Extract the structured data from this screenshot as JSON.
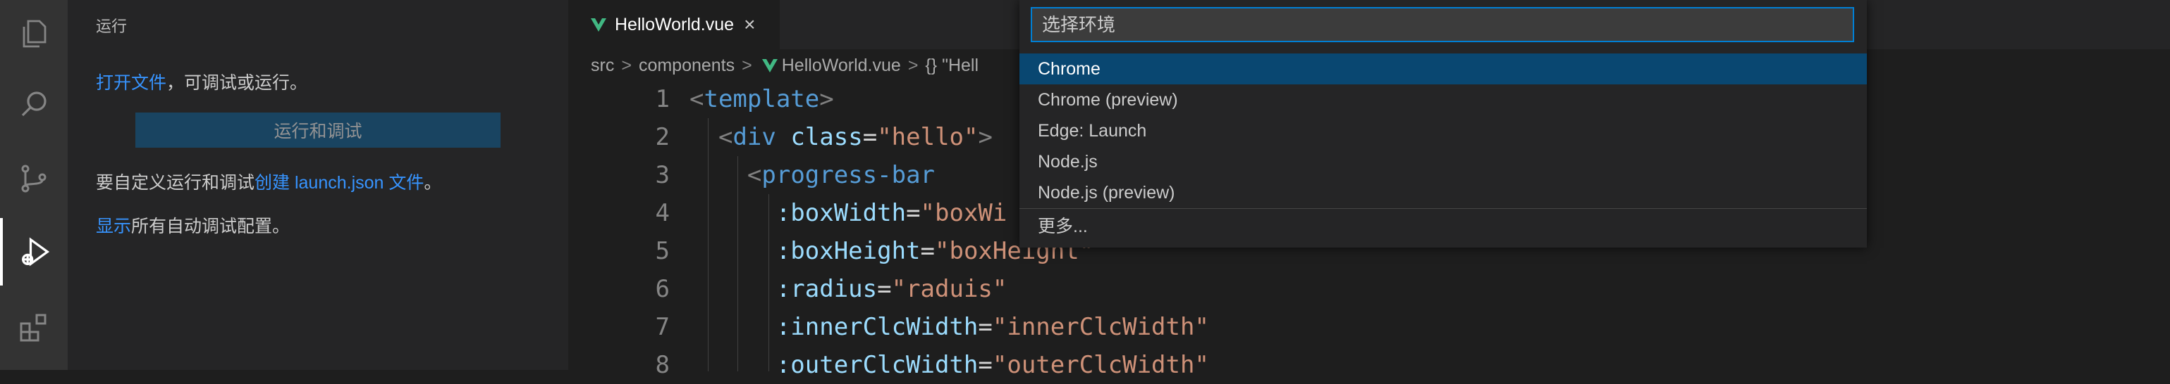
{
  "activity_bar": {
    "items": [
      {
        "name": "explorer-icon",
        "active": false
      },
      {
        "name": "search-icon",
        "active": false
      },
      {
        "name": "source-control-icon",
        "active": false
      },
      {
        "name": "run-debug-icon",
        "active": true
      },
      {
        "name": "extensions-icon",
        "active": false
      }
    ]
  },
  "sidebar": {
    "title": "运行",
    "open_file_link": "打开文件",
    "open_file_rest": "，可调试或运行。",
    "run_button": "运行和调试",
    "custom_prefix": "要自定义运行和调试",
    "create_link": "创建 launch.json 文件",
    "custom_suffix": "。",
    "show_link": "显示",
    "show_rest": "所有自动调试配置。"
  },
  "editor": {
    "tab": {
      "label": "HelloWorld.vue",
      "close": "×"
    },
    "breadcrumb": {
      "items": [
        "src",
        "components",
        "HelloWorld.vue",
        "{} \"Hell"
      ],
      "separator": ">"
    },
    "lines": [
      {
        "n": "1",
        "segs": [
          [
            "c-punc",
            "<"
          ],
          [
            "c-tag",
            "template"
          ],
          [
            "c-punc",
            ">"
          ]
        ]
      },
      {
        "n": "2",
        "segs": [
          [
            "c-plain",
            "  "
          ],
          [
            "c-punc",
            "<"
          ],
          [
            "c-tag",
            "div"
          ],
          [
            "c-plain",
            " "
          ],
          [
            "c-attr",
            "class"
          ],
          [
            "c-plain",
            "="
          ],
          [
            "c-str",
            "\"hello\""
          ],
          [
            "c-punc",
            ">"
          ]
        ]
      },
      {
        "n": "3",
        "segs": [
          [
            "c-plain",
            "    "
          ],
          [
            "c-punc",
            "<"
          ],
          [
            "c-tag",
            "progress-bar"
          ]
        ]
      },
      {
        "n": "4",
        "segs": [
          [
            "c-plain",
            "      "
          ],
          [
            "c-attr",
            ":boxWidth"
          ],
          [
            "c-plain",
            "="
          ],
          [
            "c-str",
            "\"boxWi"
          ]
        ]
      },
      {
        "n": "5",
        "segs": [
          [
            "c-plain",
            "      "
          ],
          [
            "c-attr",
            ":boxHeight"
          ],
          [
            "c-plain",
            "="
          ],
          [
            "c-str",
            "\"boxHeight\""
          ]
        ]
      },
      {
        "n": "6",
        "segs": [
          [
            "c-plain",
            "      "
          ],
          [
            "c-attr",
            ":radius"
          ],
          [
            "c-plain",
            "="
          ],
          [
            "c-str",
            "\"raduis\""
          ]
        ]
      },
      {
        "n": "7",
        "segs": [
          [
            "c-plain",
            "      "
          ],
          [
            "c-attr",
            ":innerClcWidth"
          ],
          [
            "c-plain",
            "="
          ],
          [
            "c-str",
            "\"innerClcWidth\""
          ]
        ]
      },
      {
        "n": "8",
        "segs": [
          [
            "c-plain",
            "      "
          ],
          [
            "c-attr",
            ":outerClcWidth"
          ],
          [
            "c-plain",
            "="
          ],
          [
            "c-str",
            "\"outerClcWidth\""
          ]
        ]
      }
    ]
  },
  "quick_pick": {
    "placeholder": "选择环境",
    "items": [
      "Chrome",
      "Chrome (preview)",
      "Edge: Launch",
      "Node.js",
      "Node.js (preview)"
    ],
    "selected_index": 0,
    "more": "更多..."
  },
  "colors": {
    "accent": "#007fd4",
    "selection": "#094771",
    "link": "#3794ff",
    "vue_green": "#41b883"
  }
}
